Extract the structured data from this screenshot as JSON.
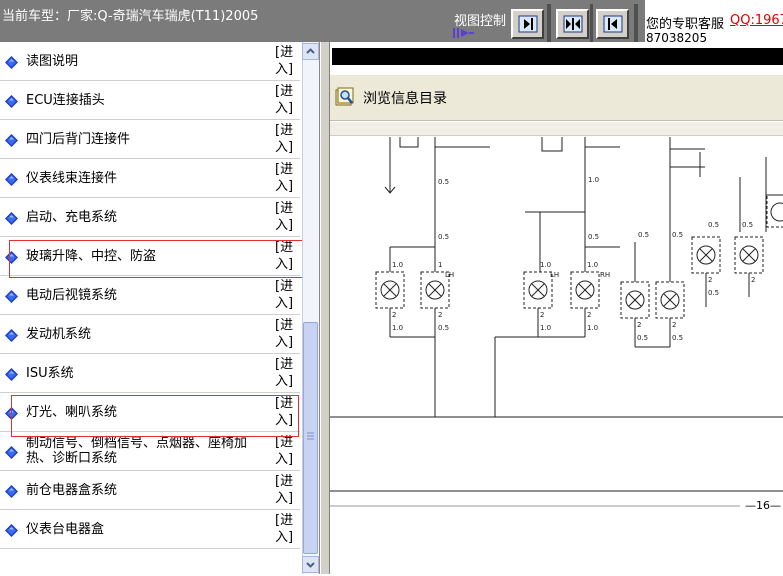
{
  "header": {
    "vehicle": "当前车型：厂家:Q-奇瑞汽车瑞虎(T11)2005",
    "view_control": "视图控制",
    "service": "您的专职客服",
    "qq": "QQ:1967",
    "qq_number": "87038205"
  },
  "sidebar": {
    "enter_label": "[进\n入]",
    "items": [
      {
        "label": "读图说明"
      },
      {
        "label": "ECU连接插头"
      },
      {
        "label": "四门后背门连接件"
      },
      {
        "label": "仪表线束连接件"
      },
      {
        "label": "启动、充电系统"
      },
      {
        "label": "玻璃升降、中控、防盗"
      },
      {
        "label": "电动后视镜系统"
      },
      {
        "label": "发动机系统"
      },
      {
        "label": "ISU系统"
      },
      {
        "label": "灯光、喇叭系统"
      },
      {
        "label": "制动信号、倒档信号、点烟器、座椅加热、诊断口系统"
      },
      {
        "label": "前仓电器盒系统"
      },
      {
        "label": "仪表台电器盒"
      }
    ]
  },
  "content": {
    "browse_title": "浏览信息目录",
    "page_number": "—16—"
  },
  "diagram": {
    "wire_sizes": [
      "0.5",
      "1.0",
      "2",
      "1",
      "0.5",
      "1.0"
    ],
    "lamp_labels": [
      "LH",
      "LH",
      "RH"
    ],
    "colors": {
      "wire": "#222222",
      "lamp_box": "#444444"
    }
  }
}
